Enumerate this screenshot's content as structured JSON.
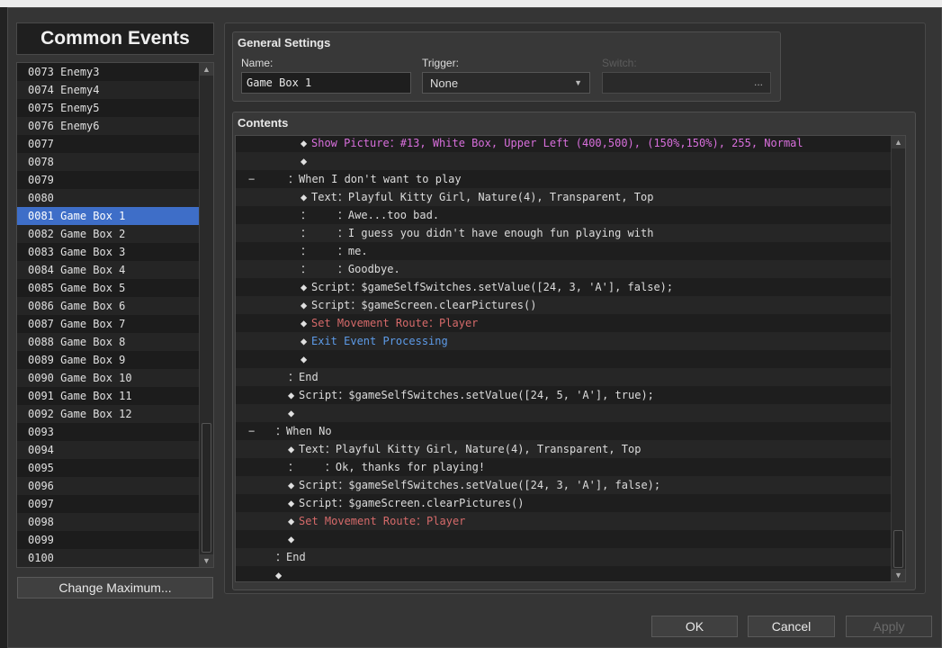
{
  "window_title": "Common Events",
  "event_list": {
    "items": [
      {
        "id": "0073",
        "name": "Enemy3"
      },
      {
        "id": "0074",
        "name": "Enemy4"
      },
      {
        "id": "0075",
        "name": "Enemy5"
      },
      {
        "id": "0076",
        "name": "Enemy6"
      },
      {
        "id": "0077",
        "name": ""
      },
      {
        "id": "0078",
        "name": ""
      },
      {
        "id": "0079",
        "name": ""
      },
      {
        "id": "0080",
        "name": ""
      },
      {
        "id": "0081",
        "name": "Game Box 1",
        "selected": true
      },
      {
        "id": "0082",
        "name": "Game Box 2"
      },
      {
        "id": "0083",
        "name": "Game Box 3"
      },
      {
        "id": "0084",
        "name": "Game Box 4"
      },
      {
        "id": "0085",
        "name": "Game Box 5"
      },
      {
        "id": "0086",
        "name": "Game Box 6"
      },
      {
        "id": "0087",
        "name": "Game Box 7"
      },
      {
        "id": "0088",
        "name": "Game Box 8"
      },
      {
        "id": "0089",
        "name": "Game Box 9"
      },
      {
        "id": "0090",
        "name": "Game Box 10"
      },
      {
        "id": "0091",
        "name": "Game Box 11"
      },
      {
        "id": "0092",
        "name": "Game Box 12"
      },
      {
        "id": "0093",
        "name": ""
      },
      {
        "id": "0094",
        "name": ""
      },
      {
        "id": "0095",
        "name": ""
      },
      {
        "id": "0096",
        "name": ""
      },
      {
        "id": "0097",
        "name": ""
      },
      {
        "id": "0098",
        "name": ""
      },
      {
        "id": "0099",
        "name": ""
      },
      {
        "id": "0100",
        "name": ""
      }
    ]
  },
  "change_maximum_label": "Change Maximum...",
  "general_settings": {
    "title": "General Settings",
    "name_label": "Name:",
    "name_value": "Game Box 1",
    "trigger_label": "Trigger:",
    "trigger_value": "None",
    "switch_label": "Switch:",
    "switch_value": "..."
  },
  "contents": {
    "title": "Contents",
    "lines": [
      {
        "indent": 4,
        "diamond": true,
        "parts": [
          {
            "text": "Show Picture：#13, White Box, Upper Left (400,500), (150%,150%), 255, Normal",
            "color": "pink"
          }
        ]
      },
      {
        "indent": 4,
        "diamond": true,
        "parts": []
      },
      {
        "indent": 3,
        "collapse": true,
        "parts": [
          {
            "text": "：When I don't want to play",
            "color": "default"
          }
        ]
      },
      {
        "indent": 4,
        "diamond": true,
        "parts": [
          {
            "text": "Text：Playful Kitty Girl, Nature(4), Transparent, Top",
            "color": "default"
          }
        ]
      },
      {
        "indent": 4,
        "parts": [
          {
            "text": "：    ：Awe...too bad.",
            "color": "default"
          }
        ]
      },
      {
        "indent": 4,
        "parts": [
          {
            "text": "：    ：I guess you didn't have enough fun playing with",
            "color": "default"
          }
        ]
      },
      {
        "indent": 4,
        "parts": [
          {
            "text": "：    ：me.",
            "color": "default"
          }
        ]
      },
      {
        "indent": 4,
        "parts": [
          {
            "text": "：    ：Goodbye.",
            "color": "default"
          }
        ]
      },
      {
        "indent": 4,
        "diamond": true,
        "parts": [
          {
            "text": "Script：$gameSelfSwitches.setValue([24, 3, 'A'], false);",
            "color": "default"
          }
        ]
      },
      {
        "indent": 4,
        "diamond": true,
        "parts": [
          {
            "text": "Script：$gameScreen.clearPictures()",
            "color": "default"
          }
        ]
      },
      {
        "indent": 4,
        "diamond": true,
        "parts": [
          {
            "text": "Set Movement Route：Player",
            "color": "red"
          }
        ]
      },
      {
        "indent": 4,
        "diamond": true,
        "parts": [
          {
            "text": "Exit Event Processing",
            "color": "blue"
          }
        ]
      },
      {
        "indent": 4,
        "diamond": true,
        "parts": []
      },
      {
        "indent": 3,
        "parts": [
          {
            "text": "：End",
            "color": "default"
          }
        ]
      },
      {
        "indent": 3,
        "diamond": true,
        "parts": [
          {
            "text": "Script：$gameSelfSwitches.setValue([24, 5, 'A'], true);",
            "color": "default"
          }
        ]
      },
      {
        "indent": 3,
        "diamond": true,
        "parts": []
      },
      {
        "indent": 2,
        "collapse": true,
        "parts": [
          {
            "text": "：When No",
            "color": "default"
          }
        ]
      },
      {
        "indent": 3,
        "diamond": true,
        "parts": [
          {
            "text": "Text：Playful Kitty Girl, Nature(4), Transparent, Top",
            "color": "default"
          }
        ]
      },
      {
        "indent": 3,
        "parts": [
          {
            "text": "：    ：Ok, thanks for playing!",
            "color": "default"
          }
        ]
      },
      {
        "indent": 3,
        "diamond": true,
        "parts": [
          {
            "text": "Script：$gameSelfSwitches.setValue([24, 3, 'A'], false);",
            "color": "default"
          }
        ]
      },
      {
        "indent": 3,
        "diamond": true,
        "parts": [
          {
            "text": "Script：$gameScreen.clearPictures()",
            "color": "default"
          }
        ]
      },
      {
        "indent": 3,
        "diamond": true,
        "parts": [
          {
            "text": "Set Movement Route：Player",
            "color": "red"
          }
        ]
      },
      {
        "indent": 3,
        "diamond": true,
        "parts": []
      },
      {
        "indent": 2,
        "parts": [
          {
            "text": "：End",
            "color": "default"
          }
        ]
      },
      {
        "indent": 2,
        "diamond": true,
        "parts": []
      }
    ]
  },
  "buttons": {
    "ok": "OK",
    "cancel": "Cancel",
    "apply": "Apply"
  },
  "colors": {
    "selection": "#3e6ec8",
    "pink": "#d86fdc",
    "red": "#d66a6a",
    "blue": "#5d9be8"
  }
}
